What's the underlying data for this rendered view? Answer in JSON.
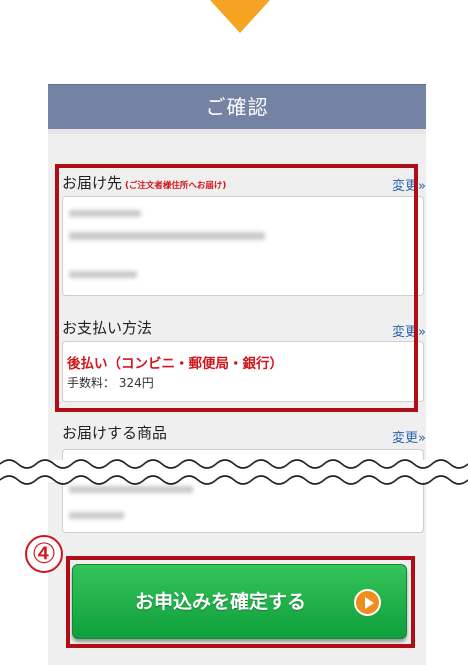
{
  "header": {
    "title": "ご確認"
  },
  "delivery": {
    "heading": "お届け先",
    "note": "(ご注文者様住所へお届け)",
    "change_label": "変更»"
  },
  "payment": {
    "heading": "お支払い方法",
    "change_label": "変更»",
    "method": "後払い（コンビニ・郵便局・銀行）",
    "fee": "手数料： 324円"
  },
  "products": {
    "heading": "お届けする商品",
    "change_label": "変更»"
  },
  "step": {
    "number": "④"
  },
  "confirm_button": {
    "label": "お申込みを確定する"
  },
  "colors": {
    "arrow": "#f6a323",
    "header": "#7483a4",
    "highlight": "#b00e17",
    "button": "#1db249",
    "accent_red": "#d0161c",
    "link": "#2a64a8"
  },
  "icons": [
    "down-arrow-icon",
    "play-icon",
    "step-number-icon"
  ]
}
